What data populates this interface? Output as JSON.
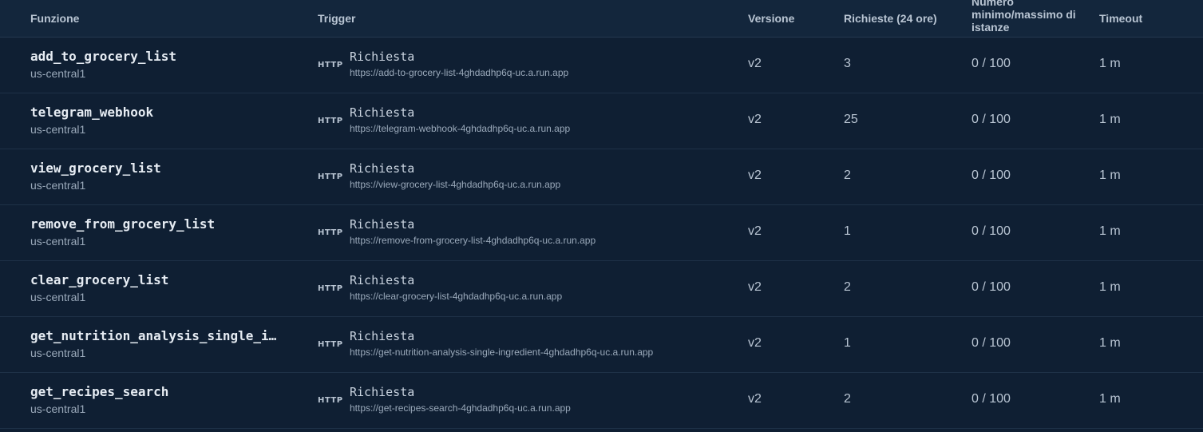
{
  "columns": {
    "funzione": "Funzione",
    "trigger": "Trigger",
    "versione": "Versione",
    "richieste": "Richieste (24 ore)",
    "istanze": "Numero minimo/massimo di istanze",
    "timeout": "Timeout"
  },
  "rows": [
    {
      "name": "add_to_grocery_list",
      "region": "us-central1",
      "badge": "HTTP",
      "trigger_type": "Richiesta",
      "url": "https://add-to-grocery-list-4ghdadhp6q-uc.a.run.app",
      "version": "v2",
      "requests": "3",
      "instances": "0 / 100",
      "timeout": "1 m"
    },
    {
      "name": "telegram_webhook",
      "region": "us-central1",
      "badge": "HTTP",
      "trigger_type": "Richiesta",
      "url": "https://telegram-webhook-4ghdadhp6q-uc.a.run.app",
      "version": "v2",
      "requests": "25",
      "instances": "0 / 100",
      "timeout": "1 m"
    },
    {
      "name": "view_grocery_list",
      "region": "us-central1",
      "badge": "HTTP",
      "trigger_type": "Richiesta",
      "url": "https://view-grocery-list-4ghdadhp6q-uc.a.run.app",
      "version": "v2",
      "requests": "2",
      "instances": "0 / 100",
      "timeout": "1 m"
    },
    {
      "name": "remove_from_grocery_list",
      "region": "us-central1",
      "badge": "HTTP",
      "trigger_type": "Richiesta",
      "url": "https://remove-from-grocery-list-4ghdadhp6q-uc.a.run.app",
      "version": "v2",
      "requests": "1",
      "instances": "0 / 100",
      "timeout": "1 m"
    },
    {
      "name": "clear_grocery_list",
      "region": "us-central1",
      "badge": "HTTP",
      "trigger_type": "Richiesta",
      "url": "https://clear-grocery-list-4ghdadhp6q-uc.a.run.app",
      "version": "v2",
      "requests": "2",
      "instances": "0 / 100",
      "timeout": "1 m"
    },
    {
      "name": "get_nutrition_analysis_single_i…",
      "region": "us-central1",
      "badge": "HTTP",
      "trigger_type": "Richiesta",
      "url": "https://get-nutrition-analysis-single-ingredient-4ghdadhp6q-uc.a.run.app",
      "version": "v2",
      "requests": "1",
      "instances": "0 / 100",
      "timeout": "1 m"
    },
    {
      "name": "get_recipes_search",
      "region": "us-central1",
      "badge": "HTTP",
      "trigger_type": "Richiesta",
      "url": "https://get-recipes-search-4ghdadhp6q-uc.a.run.app",
      "version": "v2",
      "requests": "2",
      "instances": "0 / 100",
      "timeout": "1 m"
    }
  ]
}
